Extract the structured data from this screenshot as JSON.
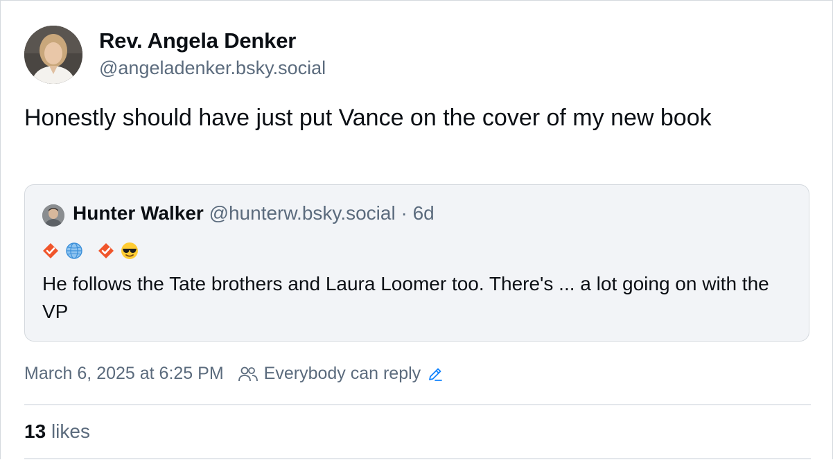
{
  "post": {
    "author_name": "Rev. Angela Denker",
    "author_handle": "@angeladenker.bsky.social",
    "text": "Honestly should have just put Vance on the cover of my new book",
    "timestamp": "March 6, 2025 at 6:25 PM",
    "reply_setting": "Everybody can reply",
    "likes_count": "13",
    "likes_label": "likes"
  },
  "quote": {
    "author_name": "Hunter Walker",
    "author_handle": "@hunterw.bsky.social",
    "separator": "·",
    "age": "6d",
    "badges": [
      "checkmark-badge-icon",
      "globe-icon",
      "checkmark-badge-icon",
      "sunglasses-emoji-icon"
    ],
    "text": "He follows the Tate brothers and Laura Loomer too. There's ... a lot going on with the VP"
  },
  "colors": {
    "text_primary": "#0b0f14",
    "text_secondary": "#5b6b7d",
    "quote_background": "#f2f4f7",
    "border": "#d4d9de",
    "accent_blue": "#1083fe",
    "badge_orange": "#f0552b"
  }
}
